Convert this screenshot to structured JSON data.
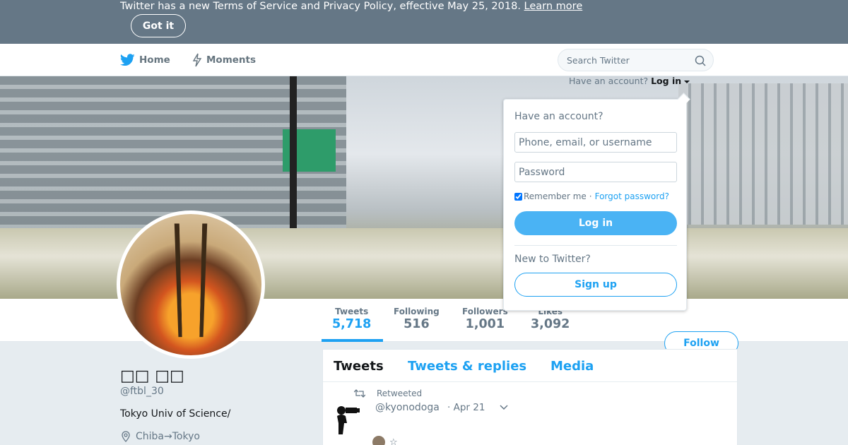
{
  "banner": {
    "message": "Twitter has a new Terms of Service and Privacy Policy, effective May 25, 2018.",
    "learn_more": "Learn more",
    "got_it": "Got it"
  },
  "nav": {
    "home": "Home",
    "moments": "Moments",
    "search_placeholder": "Search Twitter"
  },
  "login_prompt": {
    "text": "Have an account?",
    "link": "Log in"
  },
  "login_popup": {
    "title": "Have an account?",
    "username_placeholder": "Phone, email, or username",
    "password_placeholder": "Password",
    "remember_me": "Remember me",
    "separator": "·",
    "forgot_password": "Forgot password?",
    "login_button": "Log in",
    "new_to_twitter": "New to Twitter?",
    "signup_button": "Sign up"
  },
  "stats": [
    {
      "label": "Tweets",
      "value": "5,718"
    },
    {
      "label": "Following",
      "value": "516"
    },
    {
      "label": "Followers",
      "value": "1,001"
    },
    {
      "label": "Likes",
      "value": "3,092"
    }
  ],
  "follow_button": "Follow",
  "profile": {
    "name": "□□ □□",
    "handle": "@ftbl_30",
    "bio": "Tokyo Univ of Science/",
    "location": "Chiba→Tokyo"
  },
  "feed": {
    "tabs": [
      "Tweets",
      "Tweets & replies",
      "Media"
    ],
    "tweet": {
      "retweeted_label": "Retweeted",
      "author_handle": "@kyonodoga",
      "date": "· Apr 21",
      "emoji": "☆"
    }
  },
  "colors": {
    "brand": "#1da1f2",
    "banner_bg": "#657786"
  }
}
